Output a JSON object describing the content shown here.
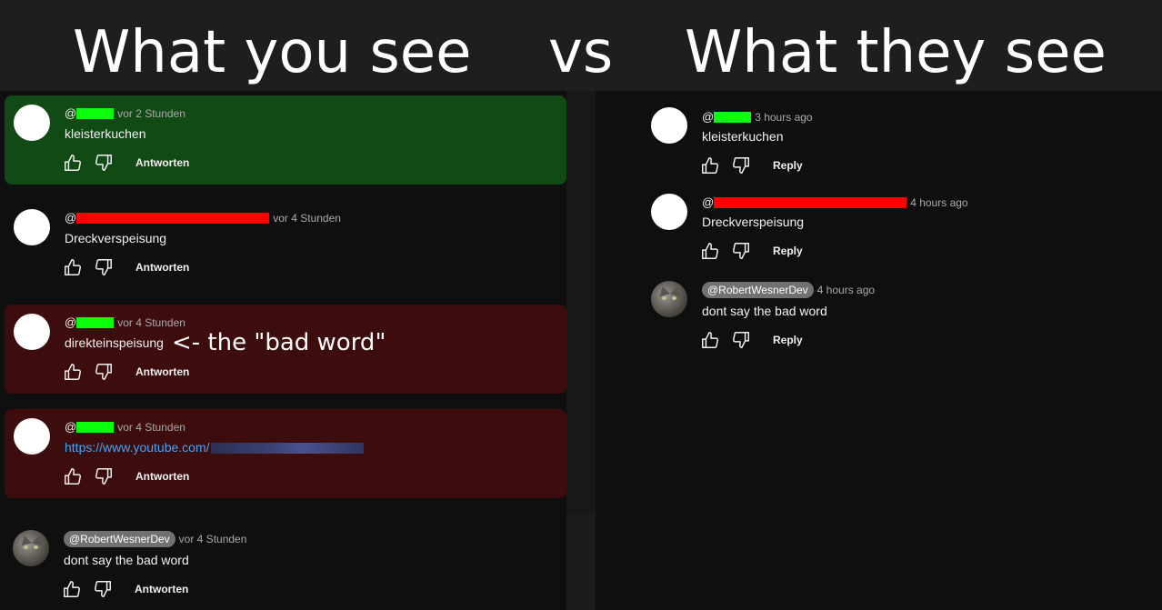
{
  "header": {
    "left_title": "What you see",
    "vs": "vs",
    "right_title": "What they see"
  },
  "colors": {
    "highlight_green": "#114a14",
    "highlight_red": "#3d0c0c",
    "redact_green": "#0aff0a",
    "redact_red": "#ff0000",
    "link": "#3ea6ff"
  },
  "left": {
    "reply_label": "Antworten",
    "comments": [
      {
        "at": "@",
        "time": "vor 2 Stunden",
        "text": "kleisterkuchen"
      },
      {
        "at": "@",
        "time": "vor 4 Stunden",
        "text": "Dreckverspeisung"
      },
      {
        "at": "@",
        "time": "vor 4 Stunden",
        "text": "direkteinspeisung",
        "note": "<- the \"bad word\""
      },
      {
        "at": "@",
        "time": "vor 4 Stunden",
        "text": "https://www.youtube.com/"
      },
      {
        "handle": "@RobertWesnerDev",
        "time": "vor 4 Stunden",
        "text": "dont say the bad word"
      }
    ]
  },
  "right": {
    "reply_label": "Reply",
    "comments": [
      {
        "at": "@",
        "time": "3 hours ago",
        "text": "kleisterkuchen"
      },
      {
        "at": "@",
        "time": "4 hours ago",
        "text": "Dreckverspeisung"
      },
      {
        "handle": "@RobertWesnerDev",
        "time": "4 hours ago",
        "text": "dont say the bad word"
      }
    ]
  },
  "icons": {
    "like": "thumbs-up-icon",
    "dislike": "thumbs-down-icon",
    "avatar": "cat-avatar"
  }
}
